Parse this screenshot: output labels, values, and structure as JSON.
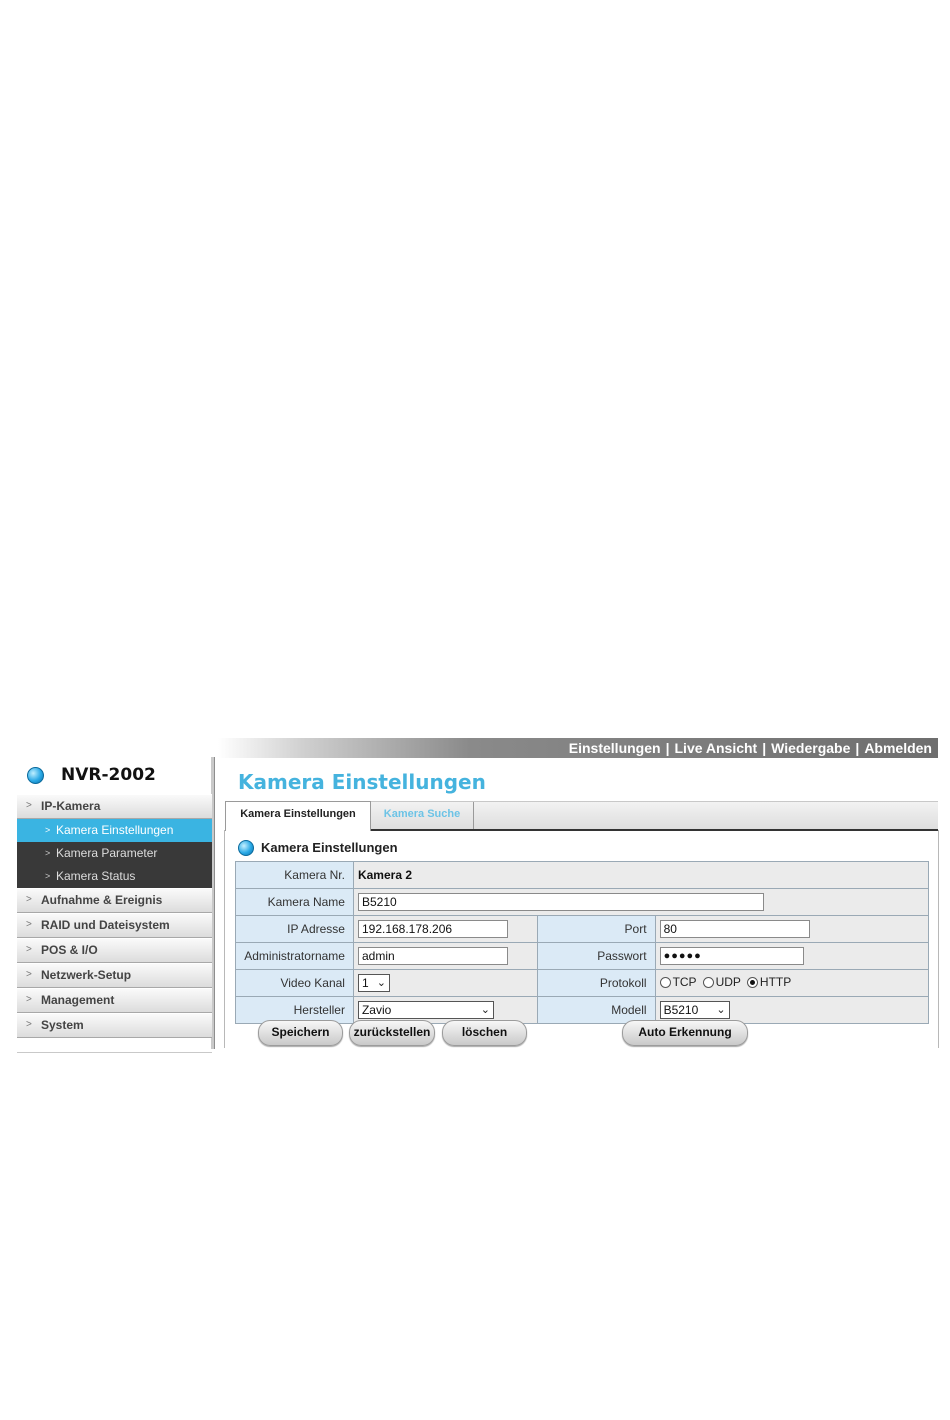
{
  "topnav": {
    "items": [
      "Einstellungen",
      "Live Ansicht",
      "Wiedergabe",
      "Abmelden"
    ],
    "separator": "|"
  },
  "logo": {
    "text": "NVR-2002"
  },
  "sidebar": {
    "items": [
      {
        "label": "IP-Kamera"
      },
      {
        "label": "Aufnahme & Ereignis"
      },
      {
        "label": "RAID und Dateisystem"
      },
      {
        "label": "POS & I/O"
      },
      {
        "label": "Netzwerk-Setup"
      },
      {
        "label": "Management"
      },
      {
        "label": "System"
      }
    ],
    "subitems": [
      {
        "label": "Kamera Einstellungen",
        "active": true
      },
      {
        "label": "Kamera Parameter",
        "active": false
      },
      {
        "label": "Kamera Status",
        "active": false
      }
    ]
  },
  "page": {
    "title": "Kamera Einstellungen"
  },
  "tabs": [
    {
      "label": "Kamera Einstellungen",
      "active": true
    },
    {
      "label": "Kamera Suche",
      "active": false
    }
  ],
  "section": {
    "title": "Kamera Einstellungen"
  },
  "form": {
    "camera_nr": {
      "label": "Kamera Nr.",
      "value": "Kamera 2"
    },
    "camera_name": {
      "label": "Kamera Name",
      "value": "B5210"
    },
    "ip_address": {
      "label": "IP Adresse",
      "value": "192.168.178.206"
    },
    "port": {
      "label": "Port",
      "value": "80"
    },
    "admin_name": {
      "label": "Administratorname",
      "value": "admin"
    },
    "password": {
      "label": "Passwort",
      "value": "●●●●●"
    },
    "video_channel": {
      "label": "Video Kanal",
      "value": "1"
    },
    "protocol": {
      "label": "Protokoll",
      "options": [
        "TCP",
        "UDP",
        "HTTP"
      ],
      "selected": "HTTP"
    },
    "manufacturer": {
      "label": "Hersteller",
      "value": "Zavio"
    },
    "model": {
      "label": "Modell",
      "value": "B5210"
    }
  },
  "buttons": {
    "save": "Speichern",
    "reset": "zurückstellen",
    "delete": "löschen",
    "auto_detect": "Auto Erkennung"
  },
  "colors": {
    "accent": "#45b3de",
    "active_menu": "#3ab4e2",
    "submenu_bg": "#393939",
    "label_bg": "#dbeaf6"
  }
}
